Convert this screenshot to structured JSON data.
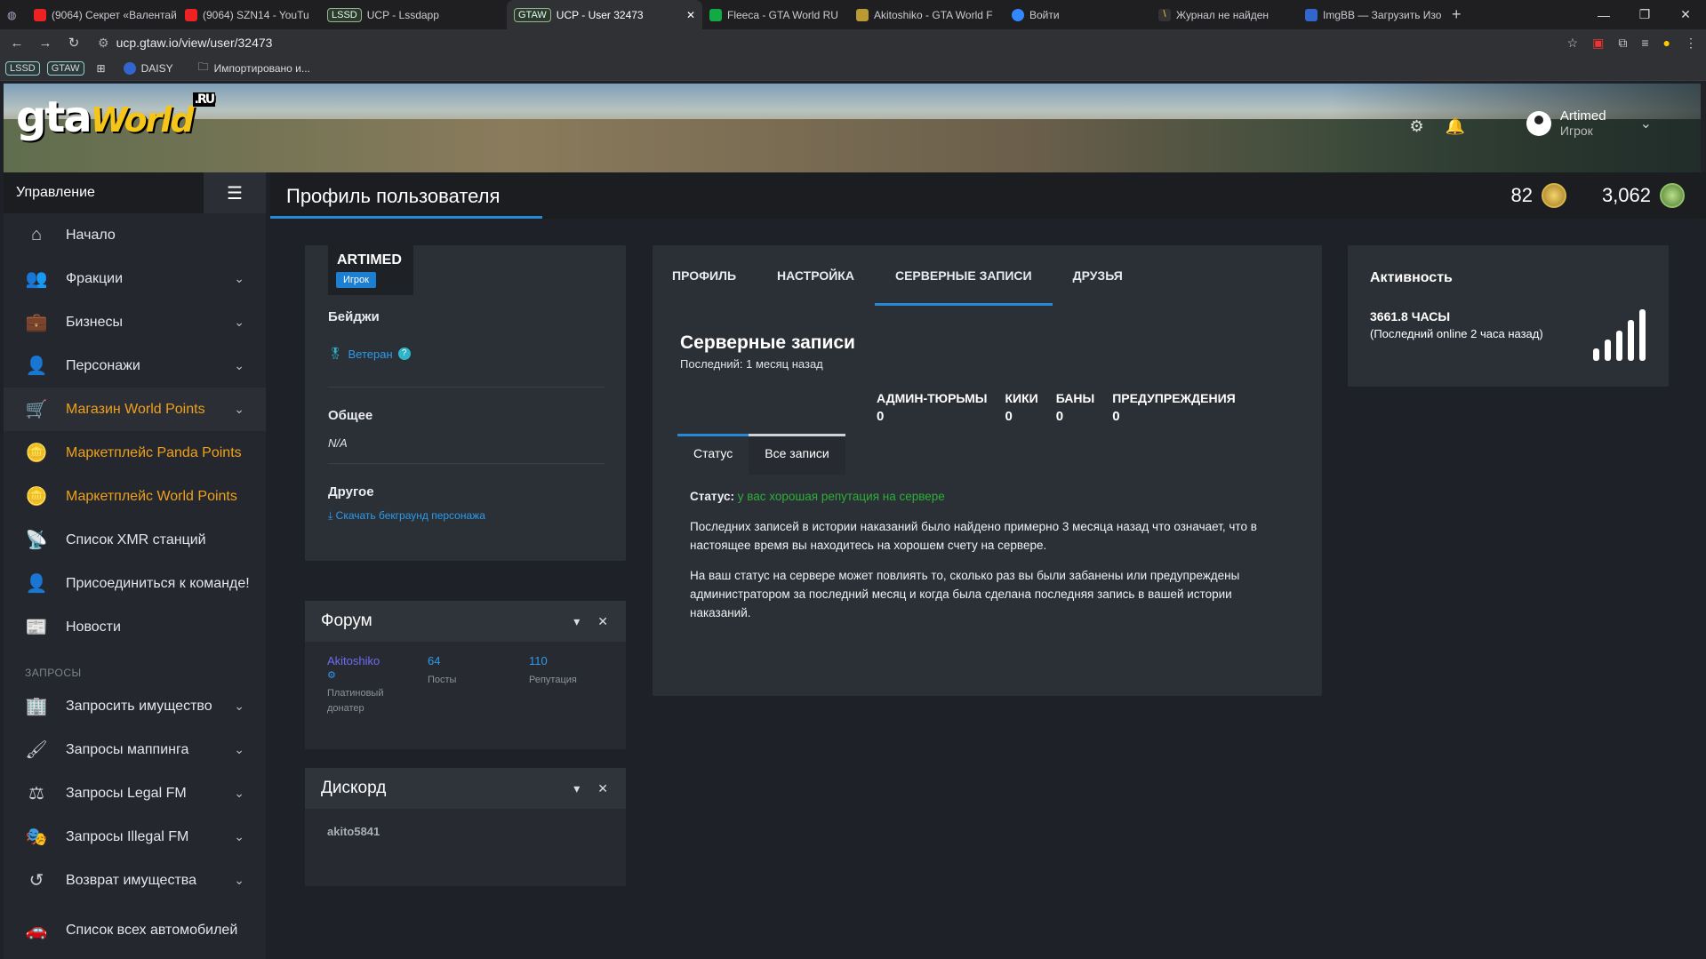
{
  "browser": {
    "tabs": [
      {
        "label": "(9064) Секрет «Валентай",
        "tag": ""
      },
      {
        "label": "(9064) SZN14 - YouTu",
        "tag": ""
      },
      {
        "label": "UCP - Lssdapp",
        "tag": "LSSD"
      },
      {
        "label": "UCP - User 32473",
        "tag": "GTAW"
      },
      {
        "label": "Fleeca - GTA World RU",
        "tag": ""
      },
      {
        "label": "Akitoshiko - GTA World F",
        "tag": ""
      },
      {
        "label": "Войти",
        "tag": ""
      },
      {
        "label": "Журнал не найден",
        "tag": ""
      },
      {
        "label": "ImgBB — Загрузить Изо",
        "tag": ""
      }
    ],
    "url": "ucp.gtaw.io/view/user/32473",
    "bookmarks": [
      "LSSD",
      "GTAW",
      "DAISY",
      "Импортировано и..."
    ]
  },
  "banner": {
    "logo_main": "gta",
    "logo_world": "World",
    "logo_ru": ".RU",
    "user_name": "Artimed",
    "user_role": "Игрок"
  },
  "sidebar": {
    "header": "Управление",
    "items": [
      {
        "label": "Начало",
        "icon": "home-icon",
        "glyph": "⌂"
      },
      {
        "label": "Фракции",
        "icon": "users-icon",
        "glyph": "👥",
        "chevron": true
      },
      {
        "label": "Бизнесы",
        "icon": "briefcase-icon",
        "glyph": "💼",
        "chevron": true
      },
      {
        "label": "Персонажи",
        "icon": "user-icon",
        "glyph": "👤",
        "chevron": true
      },
      {
        "label": "Магазин World Points",
        "icon": "cart-icon",
        "glyph": "🛒",
        "chevron": true
      },
      {
        "label": "Маркетплейс Panda Points",
        "icon": "coins-icon",
        "glyph": "🪙"
      },
      {
        "label": "Маркетплейс World Points",
        "icon": "coins-icon",
        "glyph": "🪙"
      },
      {
        "label": "Список XMR станций",
        "icon": "antenna-icon",
        "glyph": "📡"
      },
      {
        "label": "Присоединиться к команде!",
        "icon": "user-plus-icon",
        "glyph": "👤"
      },
      {
        "label": "Новости",
        "icon": "news-icon",
        "glyph": "📰"
      }
    ],
    "section_requests": "ЗАПРОСЫ",
    "request_items": [
      {
        "label": "Запросить имущество",
        "icon": "building-icon",
        "glyph": "🏢"
      },
      {
        "label": "Запросы маппинга",
        "icon": "brush-icon",
        "glyph": "🖌"
      },
      {
        "label": "Запросы Legal FM",
        "icon": "scales-icon",
        "glyph": "⚖"
      },
      {
        "label": "Запросы Illegal FM",
        "icon": "mask-icon",
        "glyph": "🎭"
      },
      {
        "label": "Возврат имущества",
        "icon": "undo-icon",
        "glyph": "↺"
      }
    ],
    "last_item": {
      "label": "Список всех автомобилей",
      "icon": "car-icon",
      "glyph": "🚗"
    }
  },
  "topbar": {
    "title": "Профиль пользователя",
    "points_1": "82",
    "points_2": "3,062"
  },
  "profile": {
    "name": "ARTIMED",
    "role": "Игрок",
    "badges_label": "Бейджи",
    "badge": "Ветеран",
    "general_label": "Общее",
    "general_value": "N/A",
    "other_label": "Другое",
    "download_link": "Скачать бекграунд персонажа"
  },
  "forum": {
    "title": "Форум",
    "username": "Akitoshiko",
    "rank": "Платиновый донатер",
    "posts": "64",
    "posts_label": "Посты",
    "rep": "110",
    "rep_label": "Репутация"
  },
  "discord": {
    "title": "Дискорд",
    "username": "akito5841"
  },
  "main": {
    "tabs": [
      "ПРОФИЛЬ",
      "НАСТРОЙКА",
      "СЕРВЕРНЫЕ ЗАПИСИ",
      "ДРУЗЬЯ"
    ],
    "title": "Серверные записи",
    "subtitle": "Последний: 1 месяц назад",
    "stats": [
      {
        "label": "АДМИН-ТЮРЬМЫ",
        "value": "0"
      },
      {
        "label": "КИКИ",
        "value": "0"
      },
      {
        "label": "БАНЫ",
        "value": "0"
      },
      {
        "label": "ПРЕДУПРЕЖДЕНИЯ",
        "value": "0"
      }
    ],
    "subtabs": [
      "Статус",
      "Все записи"
    ],
    "status_label": "Статус:",
    "status_value": "у вас хорошая репутация на сервере",
    "para1": "Последних записей в истории наказаний было найдено примерно 3 месяца назад что означает, что в настоящее время вы находитесь на хорошем счету на сервере.",
    "para2": "На ваш статус на сервере может повлиять то, сколько раз вы были забанены или предупреждены администратором за последний месяц и когда была сделана последняя запись в вашей истории наказаний."
  },
  "activity": {
    "title": "Активность",
    "hours": "3661.8 ЧАСЫ",
    "last_online": "(Последний online 2 часа назад)"
  },
  "colors": {
    "accent": "#2589d6",
    "gold": "#f0a11a",
    "good": "#2fae3a"
  }
}
